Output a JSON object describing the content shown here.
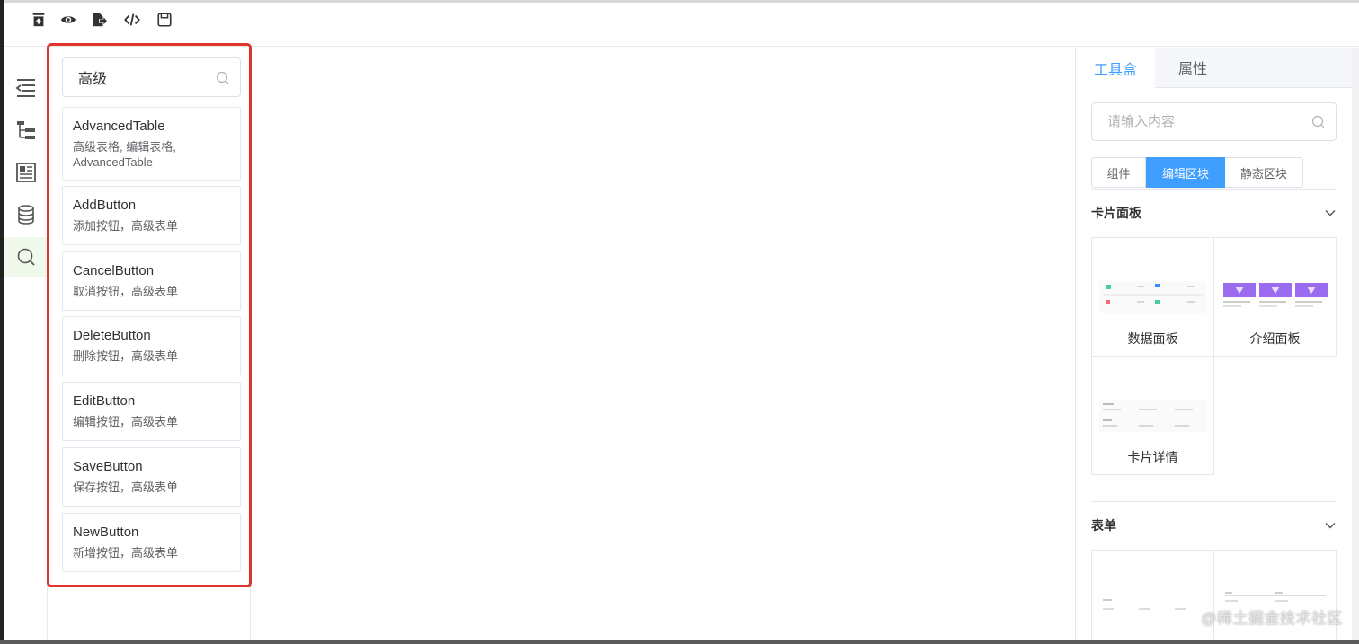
{
  "toolbar": {
    "buttons": [
      "upload-icon",
      "preview-icon",
      "export-icon",
      "code-icon",
      "save-icon"
    ]
  },
  "rail": {
    "items": [
      "outline-icon",
      "tree-icon",
      "layout-icon",
      "database-icon",
      "search-icon"
    ],
    "active": "search-icon"
  },
  "search_panel": {
    "query": "高级",
    "results": [
      {
        "name": "AdvancedTable",
        "desc": "高级表格, 编辑表格, AdvancedTable"
      },
      {
        "name": "AddButton",
        "desc": "添加按钮，高级表单"
      },
      {
        "name": "CancelButton",
        "desc": "取消按钮，高级表单"
      },
      {
        "name": "DeleteButton",
        "desc": "删除按钮，高级表单"
      },
      {
        "name": "EditButton",
        "desc": "编辑按钮，高级表单"
      },
      {
        "name": "SaveButton",
        "desc": "保存按钮，高级表单"
      },
      {
        "name": "NewButton",
        "desc": "新增按钮，高级表单"
      }
    ]
  },
  "right_panel": {
    "tabs": [
      "工具盒",
      "属性"
    ],
    "active_tab": "工具盒",
    "search_placeholder": "请输入内容",
    "segments": [
      "组件",
      "编辑区块",
      "静态区块"
    ],
    "active_segment": "编辑区块",
    "sections": [
      {
        "title": "卡片面板",
        "cards": [
          "数据面板",
          "介绍面板",
          "卡片详情"
        ]
      },
      {
        "title": "表单",
        "cards": []
      }
    ]
  },
  "watermark": "@稀土掘金技术社区",
  "colors": {
    "accent": "#409eff",
    "highlight": "#e0352b",
    "active_rail": "#f0f9eb"
  }
}
